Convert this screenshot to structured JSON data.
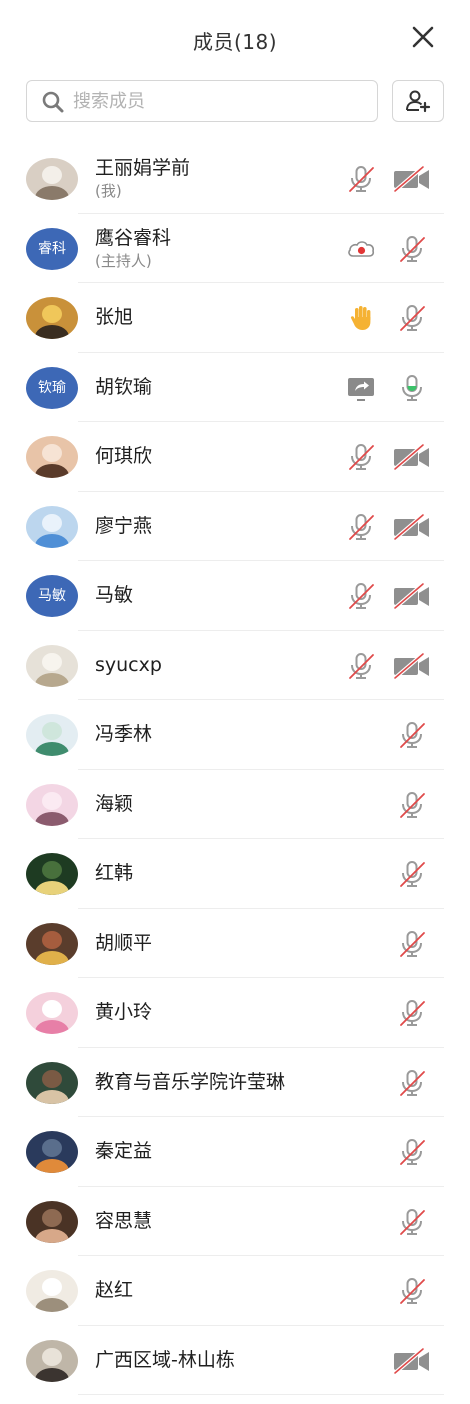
{
  "header": {
    "title": "成员(18)"
  },
  "search": {
    "placeholder": "搜索成员",
    "value": ""
  },
  "colors": {
    "accent": "#3d68b6",
    "muted_red": "#e04a4a",
    "mic_active_green": "#3cc26a",
    "hand_yellow": "#f5b233"
  },
  "members": [
    {
      "name": "王丽娟学前",
      "role": "(我)",
      "avatar": "photo",
      "icons": [
        "mic-off-icon",
        "camera-off-icon"
      ]
    },
    {
      "name": "鹰谷睿科",
      "role": "(主持人)",
      "avatar_text": "睿科",
      "icons": [
        "cloud-record-icon",
        "mic-off-icon"
      ]
    },
    {
      "name": "张旭",
      "role": "",
      "avatar": "photo",
      "icons": [
        "raised-hand-icon",
        "mic-off-icon"
      ]
    },
    {
      "name": "胡钦瑜",
      "role": "",
      "avatar_text": "钦瑜",
      "icons": [
        "screen-share-icon",
        "mic-on-icon"
      ]
    },
    {
      "name": "何琪欣",
      "role": "",
      "avatar": "photo",
      "icons": [
        "mic-off-icon",
        "camera-off-icon"
      ]
    },
    {
      "name": "廖宁燕",
      "role": "",
      "avatar": "photo",
      "icons": [
        "mic-off-icon",
        "camera-off-icon"
      ]
    },
    {
      "name": "马敏",
      "role": "",
      "avatar_text": "马敏",
      "icons": [
        "mic-off-icon",
        "camera-off-icon"
      ]
    },
    {
      "name": "syucxp",
      "role": "",
      "avatar": "photo",
      "icons": [
        "mic-off-icon",
        "camera-off-icon"
      ]
    },
    {
      "name": "冯季林",
      "role": "",
      "avatar": "photo",
      "icons": [
        "mic-off-icon"
      ]
    },
    {
      "name": "海颖",
      "role": "",
      "avatar": "photo",
      "icons": [
        "mic-off-icon"
      ]
    },
    {
      "name": "红韩",
      "role": "",
      "avatar": "photo",
      "icons": [
        "mic-off-icon"
      ]
    },
    {
      "name": "胡顺平",
      "role": "",
      "avatar": "photo",
      "icons": [
        "mic-off-icon"
      ]
    },
    {
      "name": "黄小玲",
      "role": "",
      "avatar": "photo",
      "icons": [
        "mic-off-icon"
      ]
    },
    {
      "name": "教育与音乐学院许莹琳",
      "role": "",
      "avatar": "photo",
      "icons": [
        "mic-off-icon"
      ]
    },
    {
      "name": "秦定益",
      "role": "",
      "avatar": "photo",
      "icons": [
        "mic-off-icon"
      ]
    },
    {
      "name": "容思慧",
      "role": "",
      "avatar": "photo",
      "icons": [
        "mic-off-icon"
      ]
    },
    {
      "name": "赵红",
      "role": "",
      "avatar": "photo",
      "icons": [
        "mic-off-icon"
      ]
    },
    {
      "name": "广西区域-林山栋",
      "role": "",
      "avatar": "photo",
      "icons": [
        "camera-off-icon"
      ]
    }
  ]
}
